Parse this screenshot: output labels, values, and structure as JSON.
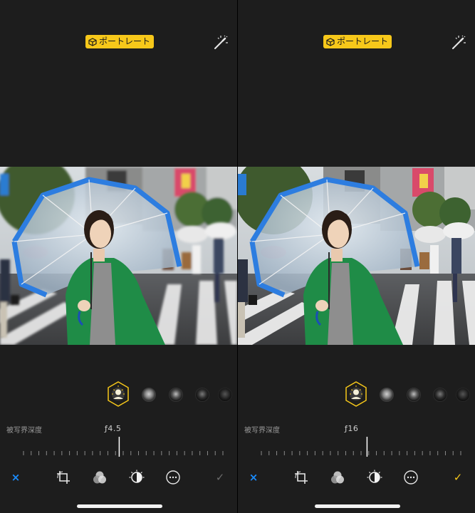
{
  "screens": [
    {
      "badge_label": "ポートレート",
      "depth_label": "被写界深度",
      "aperture_value": "ƒ4.5",
      "slider_position": 0.48,
      "cancel_label": "×",
      "done_label": "✓",
      "done_color": "#6b6b6b"
    },
    {
      "badge_label": "ポートレート",
      "depth_label": "被写界深度",
      "aperture_value": "ƒ16",
      "slider_position": 0.53,
      "cancel_label": "×",
      "done_label": "✓",
      "done_color": "#f7c81a"
    }
  ],
  "colors": {
    "accent_yellow": "#f7c81a",
    "cancel_blue": "#1a8cff",
    "background": "#1d1d1d"
  },
  "icons": {
    "badge": "portrait-cube-icon",
    "top_right": "magic-wand-icon",
    "effect_selected": "natural-light-icon",
    "toolbar": [
      "cancel-icon",
      "crop-rotate-icon",
      "filters-icon",
      "adjust-icon",
      "more-icon",
      "done-icon"
    ]
  }
}
